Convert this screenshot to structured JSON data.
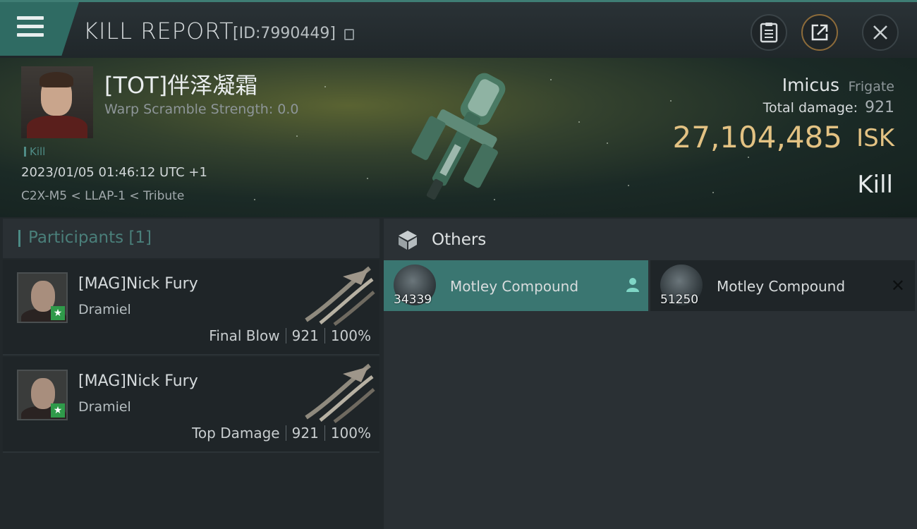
{
  "header": {
    "title": "KILL REPORT",
    "report_id": "[ID:7990449]"
  },
  "victim": {
    "name": "[TOT]伴泽凝霜",
    "warp_scramble": "Warp Scramble Strength: 0.0",
    "tag": "Kill",
    "timestamp": "2023/01/05 01:46:12 UTC +1",
    "location": "C2X-M5 < LLAP-1 < Tribute",
    "ship_name": "Imicus",
    "ship_class": "Frigate",
    "total_damage_label": "Total damage:",
    "total_damage_value": "921",
    "isk_value": "27,104,485",
    "isk_unit": "ISK",
    "result": "Kill"
  },
  "participants": {
    "title": "Participants",
    "count": "[1]",
    "rows": [
      {
        "name": "[MAG]Nick Fury",
        "ship": "Dramiel",
        "role": "Final Blow",
        "damage": "921",
        "percent": "100%"
      },
      {
        "name": "[MAG]Nick Fury",
        "ship": "Dramiel",
        "role": "Top Damage",
        "damage": "921",
        "percent": "100%"
      }
    ]
  },
  "others": {
    "title": "Others",
    "items": [
      {
        "qty": "34339",
        "name": "Motley Compound"
      },
      {
        "qty": "51250",
        "name": "Motley Compound"
      }
    ]
  },
  "colors": {
    "accent_teal": "#3a7671",
    "isk_gold": "#e3c283",
    "badge_green": "#2f9a4a"
  },
  "icons": [
    "menu-icon",
    "copy-icon",
    "clipboard-icon",
    "share-icon",
    "close-icon",
    "cube-icon",
    "person-icon",
    "star-icon"
  ]
}
